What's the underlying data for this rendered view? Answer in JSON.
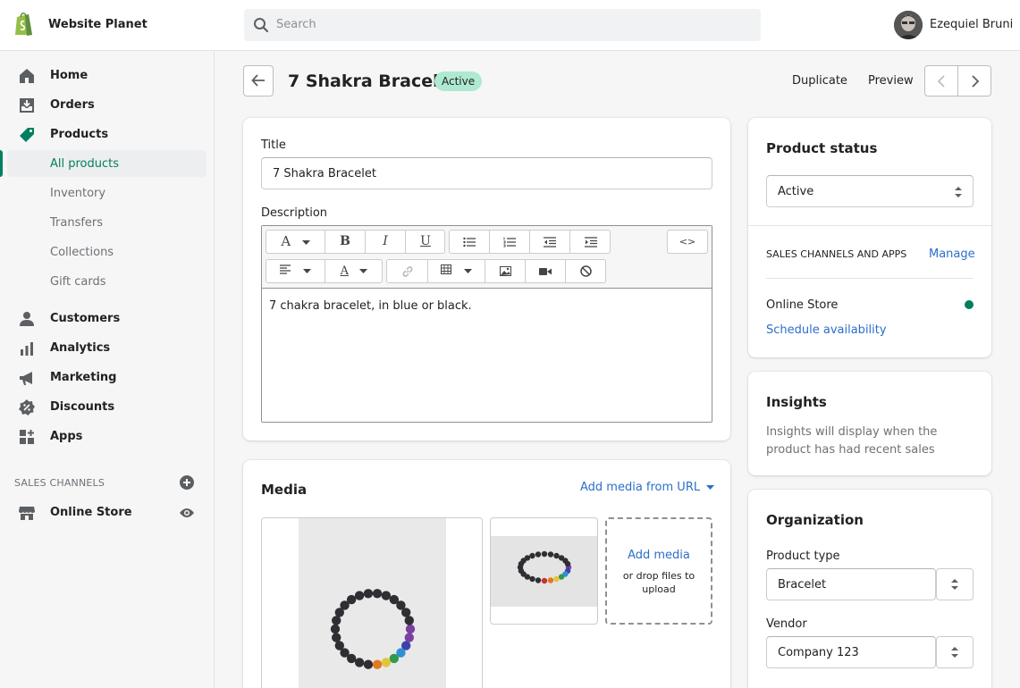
{
  "app": {
    "store_name": "Website Planet",
    "search_placeholder": "Search",
    "user_name": "Ezequiel Bruni"
  },
  "sidebar": {
    "items": [
      {
        "label": "Home",
        "icon": "home-icon"
      },
      {
        "label": "Orders",
        "icon": "orders-icon"
      },
      {
        "label": "Products",
        "icon": "tag-icon"
      },
      {
        "label": "Customers",
        "icon": "person-icon"
      },
      {
        "label": "Analytics",
        "icon": "bar-chart-icon"
      },
      {
        "label": "Marketing",
        "icon": "megaphone-icon"
      },
      {
        "label": "Discounts",
        "icon": "discount-icon"
      },
      {
        "label": "Apps",
        "icon": "apps-icon"
      }
    ],
    "product_subitems": [
      "All products",
      "Inventory",
      "Transfers",
      "Collections",
      "Gift cards"
    ],
    "sales_channels_heading": "SALES CHANNELS",
    "online_store_label": "Online Store"
  },
  "header": {
    "title": "7 Shakra Bracelet",
    "status_badge": "Active",
    "duplicate_label": "Duplicate",
    "preview_label": "Preview"
  },
  "product_form": {
    "title_label": "Title",
    "title_value": "7 Shakra Bracelet",
    "description_label": "Description",
    "description_text": "7 chakra bracelet, in blue or black.",
    "toolbar": {
      "font_glyph": "A",
      "bold_glyph": "B",
      "italic_glyph": "I",
      "underline_glyph": "U",
      "html_glyph": "<>",
      "text_color_glyph": "A"
    }
  },
  "media": {
    "title": "Media",
    "add_from_url": "Add media from URL",
    "add_media": "Add media",
    "drop_text": "or drop files to upload"
  },
  "product_status": {
    "title": "Product status",
    "selected": "Active",
    "sales_channels_heading": "SALES CHANNELS AND APPS",
    "manage_label": "Manage",
    "online_store": "Online Store",
    "schedule_label": "Schedule availability",
    "status_color": "#007f5f"
  },
  "insights": {
    "title": "Insights",
    "body": "Insights will display when the product has had recent sales"
  },
  "organization": {
    "title": "Organization",
    "product_type_label": "Product type",
    "product_type_value": "Bracelet",
    "vendor_label": "Vendor",
    "vendor_value": "Company 123"
  },
  "colors": {
    "brand_green": "#008060",
    "badge_bg": "#aee9d1",
    "link_blue": "#2c6ecb"
  }
}
